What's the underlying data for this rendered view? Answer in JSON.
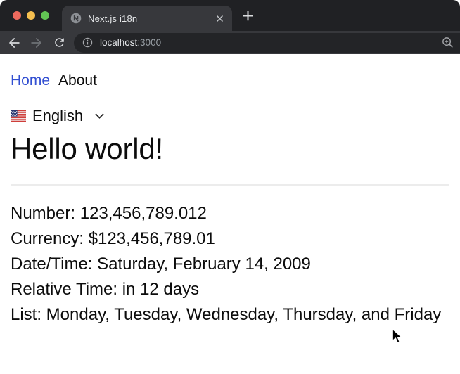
{
  "window": {
    "tab_title": "Next.js i18n",
    "url_host": "localhost",
    "url_port": ":3000"
  },
  "nav": {
    "home": "Home",
    "about": "About"
  },
  "language_selector": {
    "label": "English",
    "flag": "us-flag-icon"
  },
  "content": {
    "heading": "Hello world!",
    "lines": [
      "Number: 123,456,789.012",
      "Currency: $123,456,789.01",
      "Date/Time: Saturday, February 14, 2009",
      "Relative Time: in 12 days",
      "List: Monday, Tuesday, Wednesday, Thursday, and Friday"
    ]
  },
  "colors": {
    "chrome_frame": "#202124",
    "chrome_toolbar": "#37383c",
    "omnibox": "#232427",
    "link_blue": "#3350d2",
    "traffic_red": "#ed6a5e",
    "traffic_yellow": "#f5bf4f",
    "traffic_green": "#62c554"
  }
}
